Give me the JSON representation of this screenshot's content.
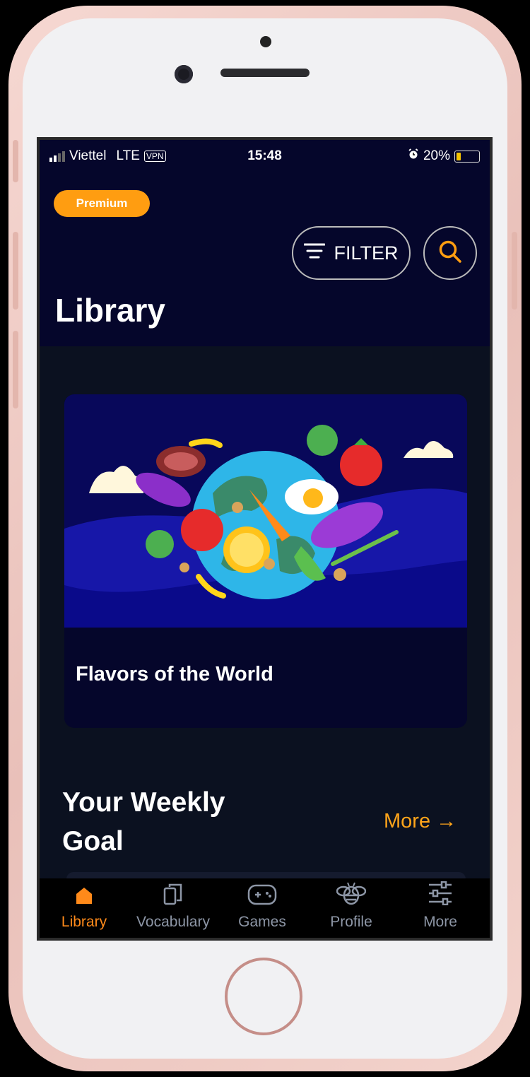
{
  "status_bar": {
    "carrier": "Viettel",
    "network": "LTE",
    "vpn": "VPN",
    "time": "15:48",
    "battery": "20%",
    "battery_level": 0.2
  },
  "header": {
    "premium_badge": "Premium",
    "filter_label": "FILTER",
    "title": "Library"
  },
  "featured_card": {
    "title": "Flavors of the World",
    "image_icon": "world-food-illustration"
  },
  "weekly_goal": {
    "title": "Your Weekly Goal",
    "more_label": "More →"
  },
  "tabbar": {
    "items": [
      {
        "label": "Library",
        "icon": "home-icon",
        "active": true
      },
      {
        "label": "Vocabulary",
        "icon": "cards-icon",
        "active": false
      },
      {
        "label": "Games",
        "icon": "gamepad-icon",
        "active": false
      },
      {
        "label": "Profile",
        "icon": "bee-icon",
        "active": false
      },
      {
        "label": "More",
        "icon": "sliders-icon",
        "active": false
      }
    ]
  },
  "colors": {
    "accent": "#ff9d11",
    "header_bg": "#05062b",
    "body_bg": "#0b1120",
    "active_tab": "#ff8a1a",
    "inactive_tab": "#8d96a6"
  }
}
